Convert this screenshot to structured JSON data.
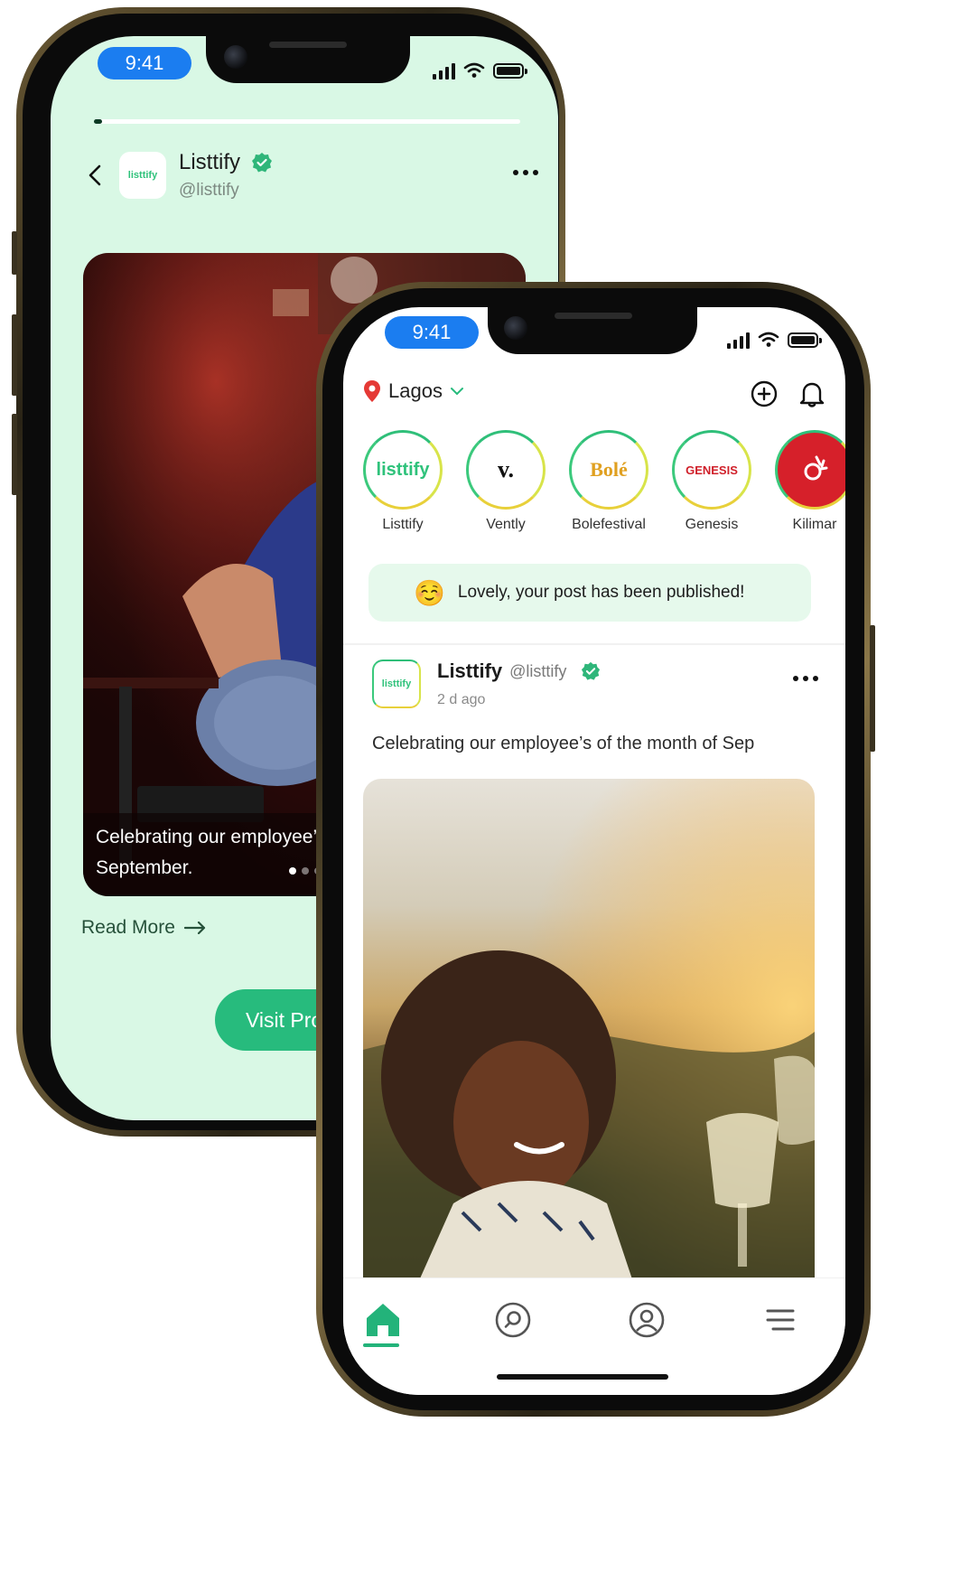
{
  "back_phone": {
    "status": {
      "time": "9:41"
    },
    "progress_fraction": 0.02,
    "profile": {
      "name": "Listtify",
      "handle": "@listtify",
      "logo_text": "listtify",
      "verified": true
    },
    "story": {
      "caption": "Celebrating our employee's of the month of September.",
      "caption_visible": "Celebrating our employee’s September.",
      "pager_count": 3,
      "pager_active": 0
    },
    "read_more": "Read More",
    "visit_button": "Visit Prof"
  },
  "front_phone": {
    "status": {
      "time": "9:41"
    },
    "location": "Lagos",
    "stories": [
      {
        "label": "Listtify",
        "logo": "listtify",
        "logo_color": "#2fc27b"
      },
      {
        "label": "Vently",
        "logo": "v.",
        "logo_color": "#111111"
      },
      {
        "label": "Bolefestival",
        "logo": "Bolé",
        "logo_color": "#e0a020"
      },
      {
        "label": "Genesis",
        "logo": "GENESIS",
        "logo_color": "#d0202a"
      },
      {
        "label": "Kilimar",
        "logo": "",
        "logo_color": "#d6202a"
      }
    ],
    "toast": {
      "emoji": "☺️",
      "text": "Lovely, your post has been published!"
    },
    "post": {
      "name": "Listtify",
      "handle": "@listtify",
      "time": "2 d ago",
      "text": "Celebrating our employee’s of the month of Sep",
      "logo_text": "listtify"
    },
    "tabs": [
      "home-icon",
      "search-icon",
      "profile-icon",
      "menu-icon"
    ],
    "active_tab": "home-icon"
  },
  "colors": {
    "brand_green": "#27bb7d",
    "mint_bg": "#d9f8e5",
    "time_pill": "#1b7df0",
    "location_pin": "#e53935",
    "verified": "#2fb67a"
  }
}
